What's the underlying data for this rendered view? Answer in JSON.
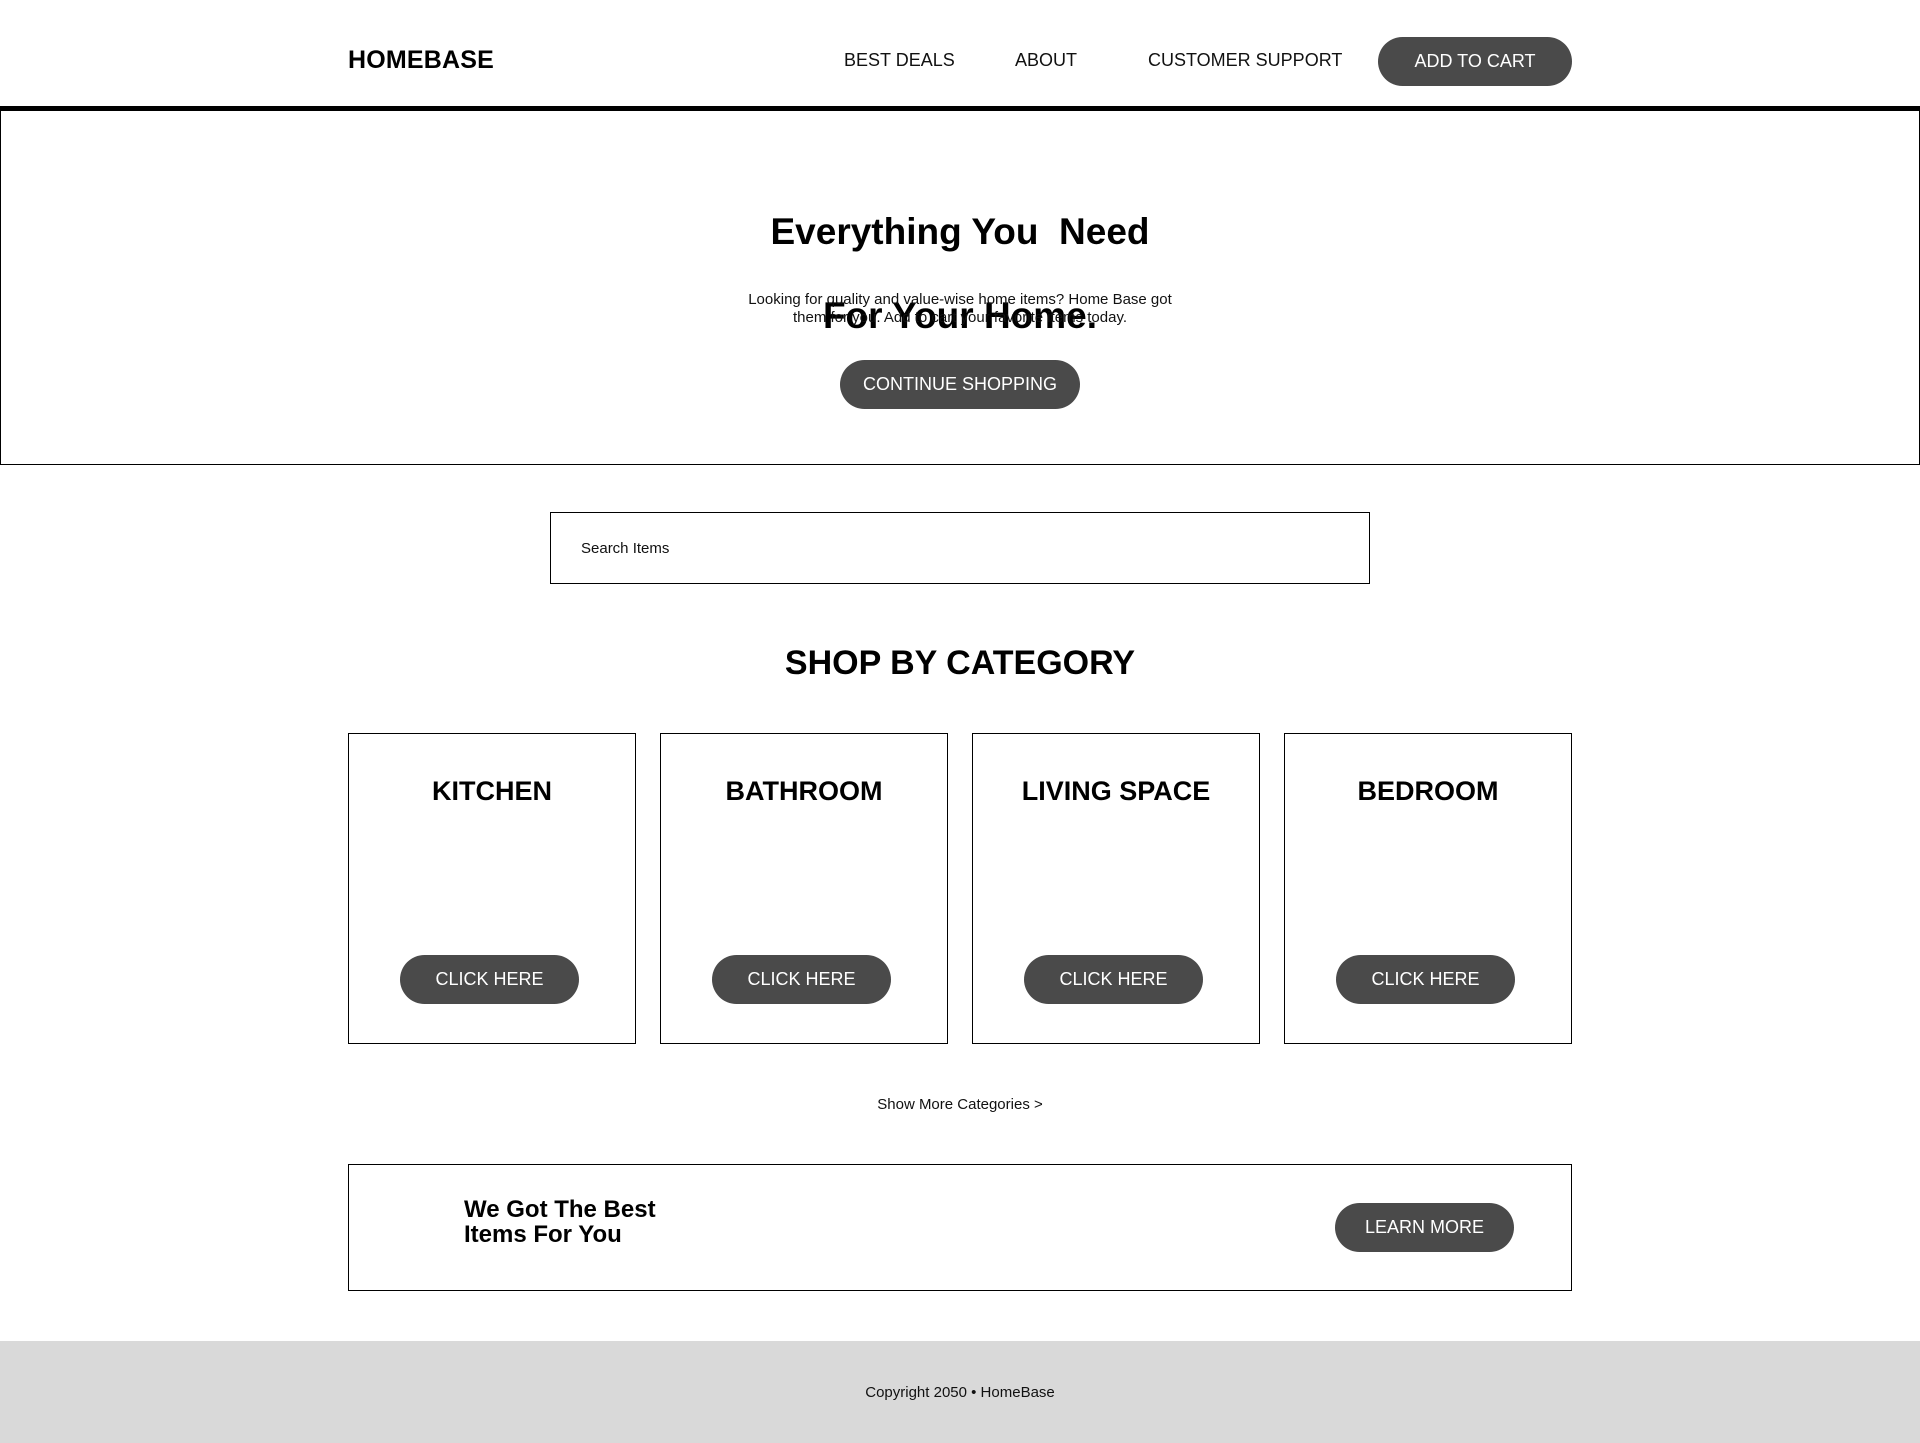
{
  "header": {
    "logo": "HOMEBASE",
    "nav": [
      {
        "label": "BEST DEALS"
      },
      {
        "label": "ABOUT"
      },
      {
        "label": "CUSTOMER SUPPORT"
      }
    ],
    "cta_label": "ADD TO CART"
  },
  "hero": {
    "title_line1": "Everything You  Need",
    "title_line2": "For Your Home.",
    "subtitle_line1": "Looking for quality and value-wise home items? Home Base got",
    "subtitle_line2": "them for you. Add to cart your favorite items today.",
    "button_label": "CONTINUE SHOPPING"
  },
  "search": {
    "placeholder": "Search Items",
    "value": ""
  },
  "categories": {
    "title": "SHOP BY CATEGORY",
    "items": [
      {
        "name": "KITCHEN",
        "button": "CLICK HERE"
      },
      {
        "name": "BATHROOM",
        "button": "CLICK HERE"
      },
      {
        "name": "LIVING SPACE",
        "button": "CLICK HERE"
      },
      {
        "name": "BEDROOM",
        "button": "CLICK HERE"
      }
    ],
    "show_more": "Show More Categories >"
  },
  "banner": {
    "title_line1": "We Got The Best",
    "title_line2": "Items For You",
    "button_label": "LEARN MORE"
  },
  "footer": {
    "text": "Copyright 2050 • HomeBase"
  },
  "colors": {
    "button_bg": "#4a4a4a",
    "footer_bg": "#d9d9d9"
  }
}
